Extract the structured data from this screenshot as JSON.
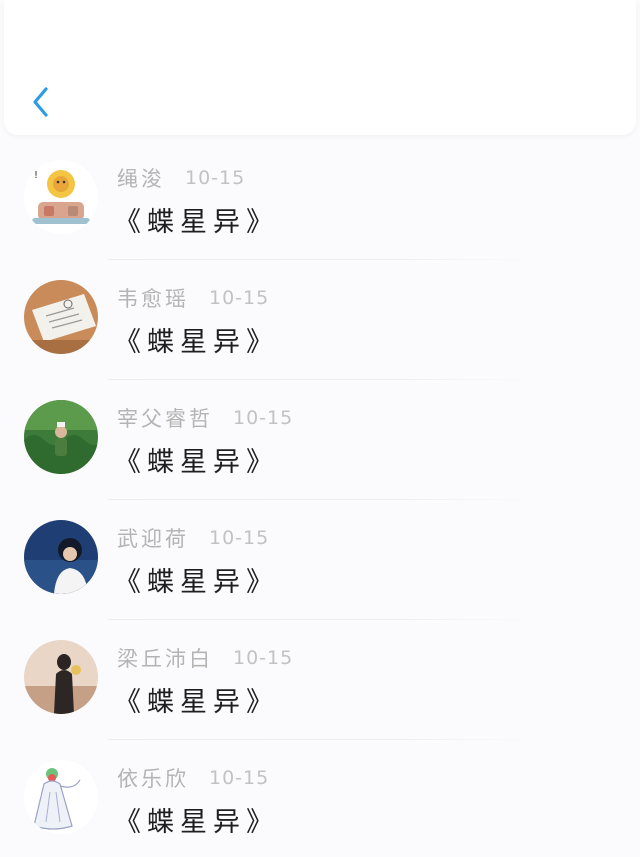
{
  "header": {
    "back_icon": "chevron-left-icon",
    "accent_color": "#2f9be3"
  },
  "items": [
    {
      "name": "绳浚",
      "date": "10-15",
      "title": "《蝶星异》",
      "avatar": "sunflower-cartoon-avatar"
    },
    {
      "name": "韦愈瑶",
      "date": "10-15",
      "title": "《蝶星异》",
      "avatar": "newspaper-photo-avatar"
    },
    {
      "name": "宰父睿哲",
      "date": "10-15",
      "title": "《蝶星异》",
      "avatar": "person-in-grass-avatar"
    },
    {
      "name": "武迎荷",
      "date": "10-15",
      "title": "《蝶星异》",
      "avatar": "person-by-sea-avatar"
    },
    {
      "name": "梁丘沛白",
      "date": "10-15",
      "title": "《蝶星异》",
      "avatar": "couple-photo-avatar"
    },
    {
      "name": "依乐欣",
      "date": "10-15",
      "title": "《蝶星异》",
      "avatar": "white-figure-illustration-avatar"
    }
  ]
}
